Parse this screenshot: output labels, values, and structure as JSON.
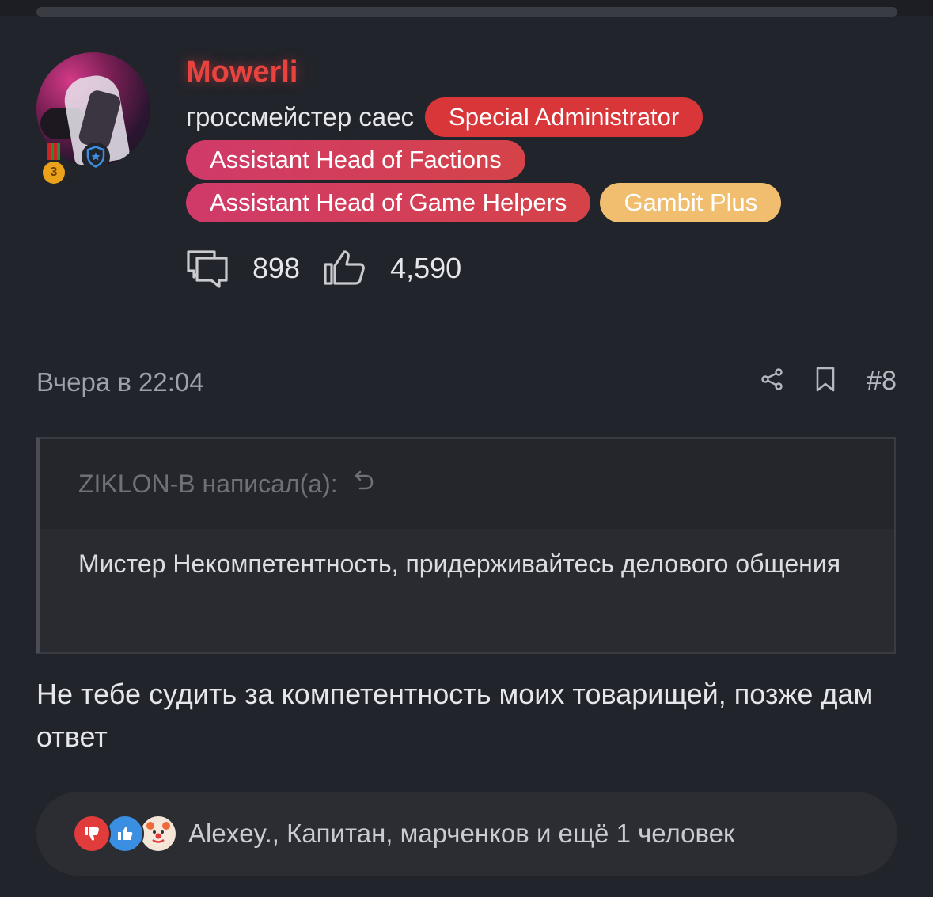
{
  "user": {
    "name": "Mowerli",
    "title": "гроссмейстер саес",
    "badges": {
      "b1": "Special Administrator",
      "b2": "Assistant Head of Factions",
      "b3": "Assistant Head of Game Helpers",
      "b4": "Gambit Plus"
    },
    "medal_number": "3",
    "stats": {
      "messages": "898",
      "likes": "4,590"
    }
  },
  "post": {
    "time": "Вчера в 22:04",
    "number": "#8",
    "quote": {
      "author": "ZIKLON-B написал(а):",
      "text": "Мистер Некомпетентность, придерживайтесь делового общения"
    },
    "message": "Не тебе судить за компетентность моих товарищей, позже дам ответ",
    "reactions_text": "Alexey., Капитан, марченков и ещё 1 человек"
  },
  "colors": {
    "background": "#22242b",
    "username": "#e8433f",
    "badge_red": "#d9363a",
    "badge_gold": "#f0be6e"
  },
  "icons": [
    "medal-icon",
    "shield-star-icon",
    "messages-icon",
    "thumbs-up-icon",
    "share-icon",
    "bookmark-icon",
    "reply-arrow-icon",
    "dislike-reaction-icon",
    "like-reaction-icon",
    "clown-reaction-icon"
  ]
}
